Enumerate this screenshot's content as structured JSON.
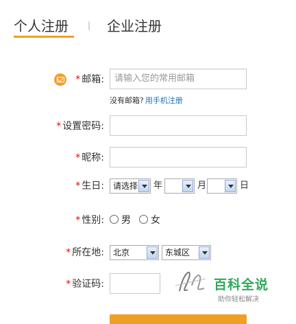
{
  "tabs": {
    "personal": "个人注册",
    "separator": "|",
    "enterprise": "企业注册"
  },
  "form": {
    "required_mark": "*",
    "email": {
      "label": "邮箱:",
      "placeholder": "请输入您的常用邮箱"
    },
    "email_hint": {
      "text": "没有邮箱?",
      "link": "用手机注册"
    },
    "password": {
      "label": "设置密码:"
    },
    "nickname": {
      "label": "昵称:"
    },
    "birthday": {
      "label": "生日:",
      "year_value": "请选择",
      "year_unit": "年",
      "month_value": "",
      "month_unit": "月",
      "day_value": "",
      "day_unit": "日"
    },
    "gender": {
      "label": "性别:",
      "male": "男",
      "female": "女"
    },
    "location": {
      "label": "所在地:",
      "province": "北京",
      "district": "东城区"
    },
    "captcha": {
      "label": "验证码:"
    }
  },
  "watermark": {
    "title": "百科全说",
    "subtitle": "助你轻松解决"
  },
  "icons": {
    "email": "mail-icon",
    "select_arrow": "chevron-down-icon"
  },
  "colors": {
    "accent": "#f0a020",
    "required": "#e00000",
    "link": "#1a6fb5",
    "watermark": "#2ea85a"
  }
}
